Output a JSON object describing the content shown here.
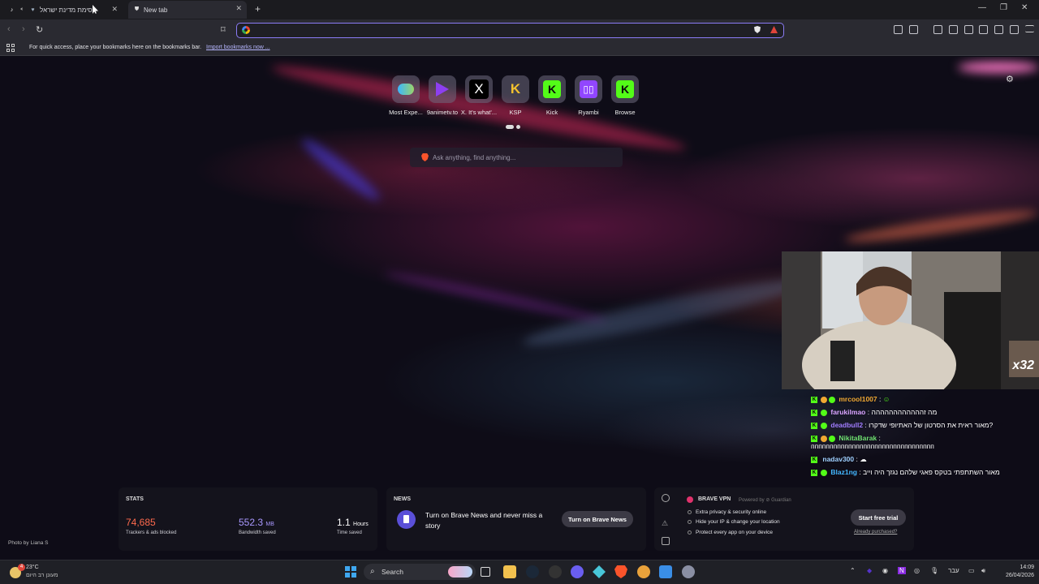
{
  "tabs": [
    {
      "label": "חסימת מדינת ישראל",
      "icon": "tiktok-icon"
    },
    {
      "label": "New tab",
      "icon": "brave-shield-icon"
    }
  ],
  "omnibox": {
    "value": "",
    "placeholder": ""
  },
  "bookmarks_bar": {
    "message": "For quick access, place your bookmarks here on the bookmarks bar.",
    "link": "Import bookmarks now ..."
  },
  "top_sites": [
    {
      "label": "Most Expe...",
      "icon": "mostexpensive-icon"
    },
    {
      "label": "9animetv.to",
      "icon": "play-icon"
    },
    {
      "label": "X. It's what'...",
      "icon": "x-icon"
    },
    {
      "label": "KSP",
      "icon": "ksp-icon"
    },
    {
      "label": "Kick",
      "icon": "kick-icon"
    },
    {
      "label": "Ryambi",
      "icon": "twitch-icon"
    },
    {
      "label": "Browse",
      "icon": "kick-icon"
    }
  ],
  "search": {
    "placeholder": "Ask anything, find anything..."
  },
  "stats": {
    "title": "STATS",
    "trackers": {
      "value": "74,685",
      "label": "Trackers & ads blocked",
      "color": "#ff6a4d"
    },
    "bandwidth": {
      "value": "552.3",
      "unit": "MB",
      "label": "Bandwidth saved",
      "color": "#a998ff"
    },
    "time": {
      "value": "1.1",
      "unit": "Hours",
      "label": "Time saved"
    }
  },
  "news": {
    "title": "NEWS",
    "text": "Turn on Brave News and never miss a story",
    "button": "Turn on Brave News"
  },
  "vpn": {
    "title": "BRAVE VPN",
    "powered": "Powered by",
    "provider": "Guardian",
    "items": [
      "Extra privacy & security online",
      "Hide your IP & change your location",
      "Protect every app on your device"
    ],
    "button": "Start free trial",
    "link": "Already purchased?"
  },
  "photo_credit": "Photo by Liana S",
  "chat": [
    {
      "user": "mrcool1007",
      "color": "#f0a832",
      "msg": ""
    },
    {
      "user": "farukilmao",
      "color": "#d9a4ff",
      "msg": "מה זהההההההההההה"
    },
    {
      "user": "deadbull2",
      "color": "#a07cff",
      "msg": "מאור ראית את הסרטון של האתיופי שדקרו?"
    },
    {
      "user": "NikitaBarak",
      "color": "#6fe070",
      "msg": "ппппппппппппппппппппппппппппппппп"
    },
    {
      "user": "nadav300",
      "color": "#9fd0ff",
      "msg": ""
    },
    {
      "user": "Blaz1ng",
      "color": "#43b6ff",
      "msg": "מאור השתתפתי בטקס פאגי שלהם נגזך היה וייב"
    }
  ],
  "cam_overlay_text": "x32",
  "taskbar": {
    "weather": {
      "temp": "23°C",
      "desc": "מעונן רב היום",
      "alerts": "4"
    },
    "search": "Search",
    "lang": "עבר",
    "time": "14:09",
    "date": "26/04/2026"
  }
}
